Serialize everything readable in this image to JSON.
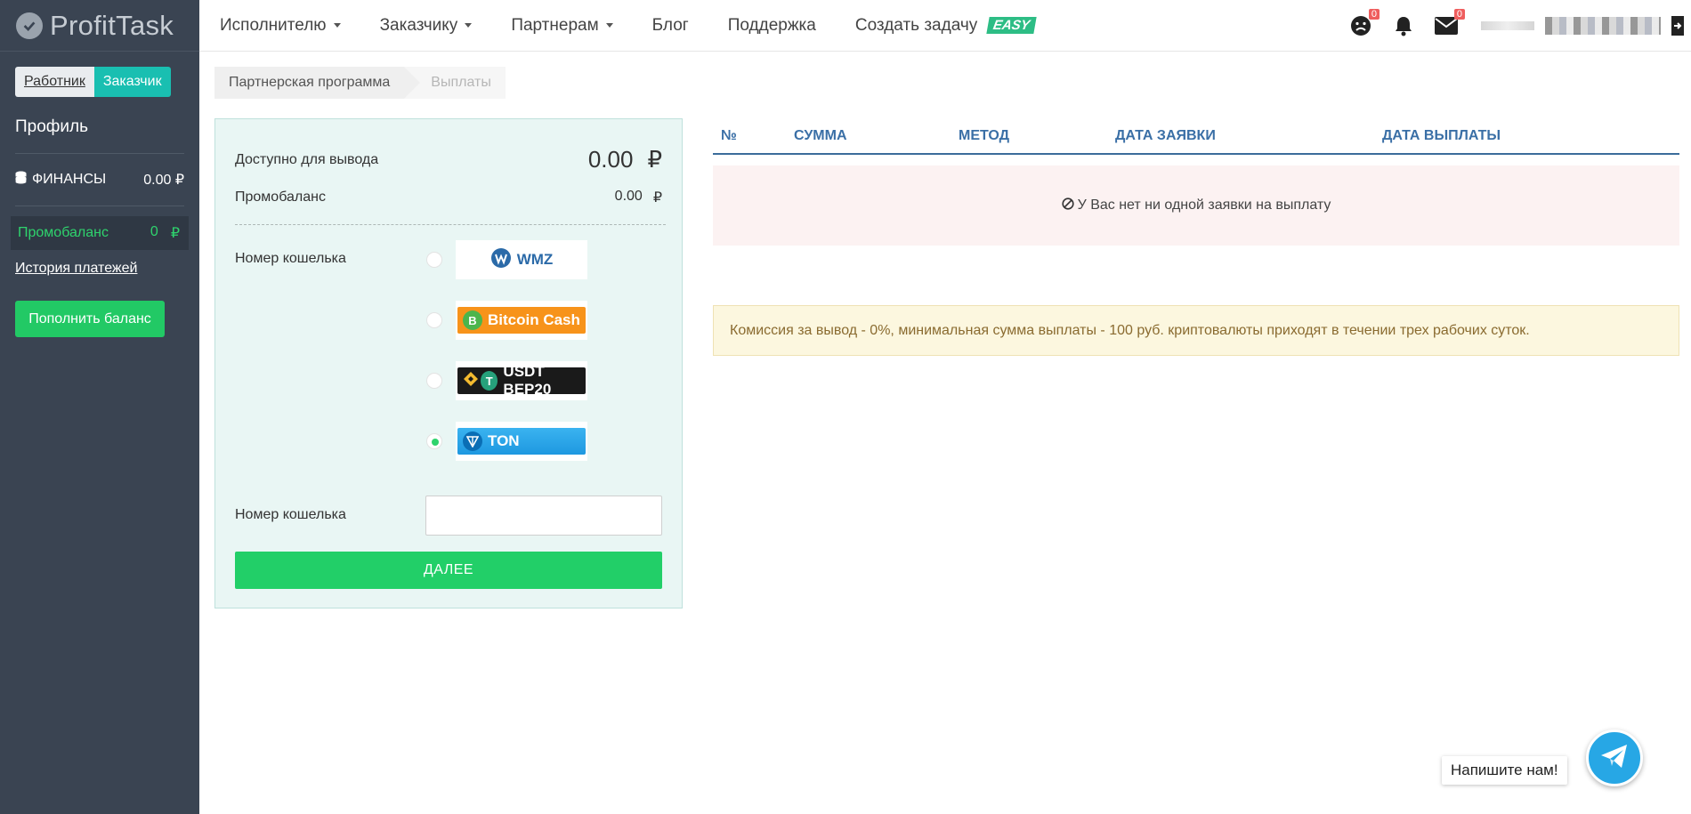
{
  "app": {
    "logo_text": "ProfitTask"
  },
  "sidebar": {
    "role_worker": "Работник",
    "role_customer": "Заказчик",
    "profile_title": "Профиль",
    "finance_label": "ФИНАНСЫ",
    "finance_value": "0.00 ₽",
    "promo_label": "Промобаланс",
    "promo_value": "0",
    "promo_currency": "₽",
    "history_link": "История платежей",
    "topup_button": "Пополнить баланс"
  },
  "nav": {
    "items": [
      "Исполнителю",
      "Заказчику",
      "Партнерам",
      "Блог",
      "Поддержка",
      "Создать задачу"
    ],
    "easy_badge": "EASY",
    "mood_badge": "0",
    "mail_badge": "0"
  },
  "breadcrumb": {
    "items": [
      "Партнерская программа",
      "Выплаты"
    ]
  },
  "withdraw": {
    "available_label": "Доступно для вывода",
    "available_value": "0.00",
    "currency": "₽",
    "promo_label": "Промобаланс",
    "promo_value": "0.00",
    "wallet_label": "Номер кошелька",
    "methods": [
      "WMZ",
      "Bitcoin Cash",
      "USDT BEP20",
      "TON"
    ],
    "selected_method": "TON",
    "wallet_input_label": "Номер кошелька",
    "wallet_input_value": "",
    "next_button": "ДАЛЕЕ"
  },
  "payouts": {
    "columns": [
      "№",
      "СУММА",
      "МЕТОД",
      "ДАТА ЗАЯВКИ",
      "ДАТА ВЫПЛАТЫ"
    ],
    "empty_text": "У Вас нет ни одной заявки на выплату",
    "commission_note": "Комиссия за вывод - 0%, минимальная сумма выплаты - 100 руб. криптовалюты приходят в течении трех рабочих суток."
  },
  "chat": {
    "label": "Напишите нам!"
  },
  "colors": {
    "sidebar_bg": "#3a4452",
    "accent_green": "#22c965",
    "accent_teal": "#19bfb1",
    "table_header": "#3a6fa6"
  }
}
